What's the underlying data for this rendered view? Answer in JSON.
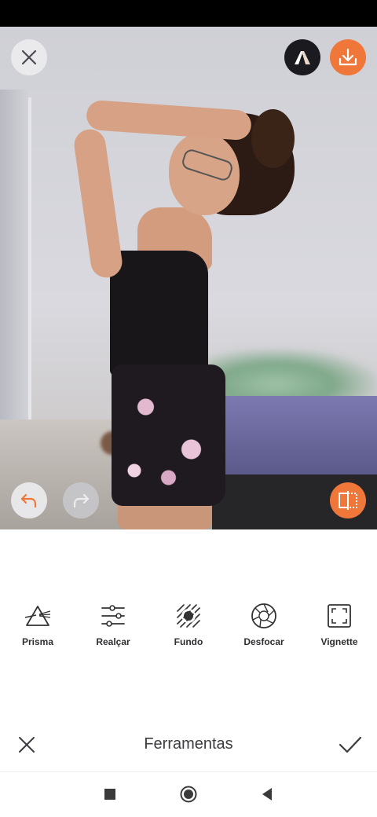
{
  "photo_toolbar": {
    "close_icon": "close-icon",
    "brand_icon": "airbrush-logo-icon",
    "download_icon": "download-icon",
    "undo_icon": "undo-icon",
    "redo_icon": "redo-icon",
    "compare_icon": "compare-icon"
  },
  "tools": [
    {
      "label": "Prisma",
      "icon": "prism-icon"
    },
    {
      "label": "Realçar",
      "icon": "sliders-icon"
    },
    {
      "label": "Fundo",
      "icon": "background-icon"
    },
    {
      "label": "Desfocar",
      "icon": "aperture-icon"
    },
    {
      "label": "Vignette",
      "icon": "vignette-icon"
    }
  ],
  "bottom_bar": {
    "title": "Ferramentas",
    "cancel_icon": "close-icon",
    "confirm_icon": "check-icon"
  },
  "colors": {
    "accent": "#f0773a",
    "status_bar": "#000000",
    "text": "#2f2f33"
  },
  "nav": {
    "recents_icon": "square-icon",
    "home_icon": "circle-icon",
    "back_icon": "triangle-back-icon"
  }
}
